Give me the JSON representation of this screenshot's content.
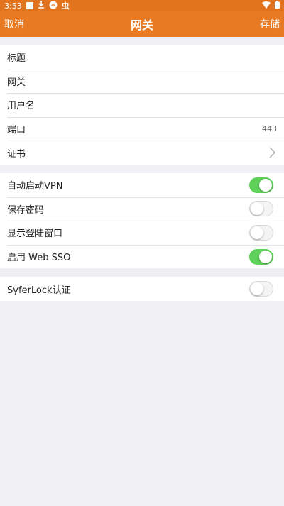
{
  "status_bar": {
    "time": "3:53",
    "carrier_glyph": "虫"
  },
  "nav": {
    "cancel": "取消",
    "title": "网关",
    "save": "存储"
  },
  "fields": [
    {
      "label": "标题",
      "value": ""
    },
    {
      "label": "网关",
      "value": ""
    },
    {
      "label": "用户名",
      "value": ""
    },
    {
      "label": "端口",
      "value": "443"
    },
    {
      "label": "证书",
      "value": ""
    }
  ],
  "toggles": [
    {
      "label": "自动启动VPN",
      "on": true
    },
    {
      "label": "保存密码",
      "on": false
    },
    {
      "label": "显示登陆窗口",
      "on": false
    },
    {
      "label": "启用 Web SSO",
      "on": true
    }
  ],
  "syferlock": {
    "label": "SyferLock认证",
    "on": false
  },
  "colors": {
    "accent": "#e77a22",
    "toggle_on": "#5fd15a",
    "background": "#efeff4"
  }
}
